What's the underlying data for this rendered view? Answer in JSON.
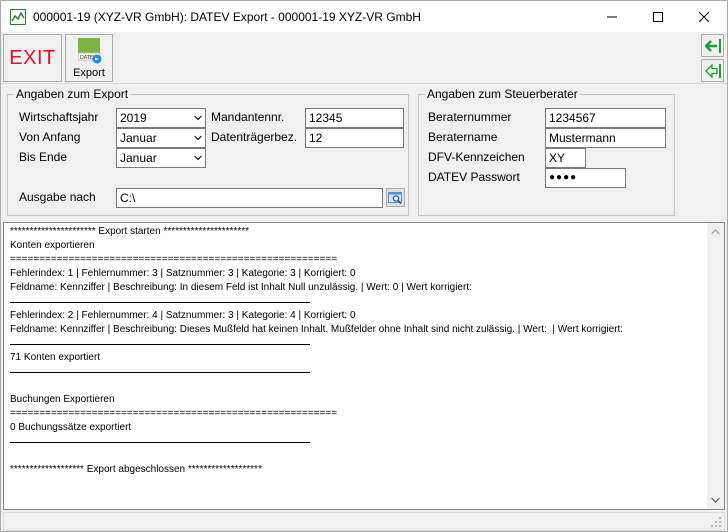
{
  "window": {
    "title": "000001-19 (XYZ-VR GmbH): DATEV Export - 000001-19 XYZ-VR GmbH"
  },
  "toolbar": {
    "exit_label": "EXIT",
    "export_label": "Export",
    "export_icon_text": "DATEV"
  },
  "export_group": {
    "legend": "Angaben zum Export",
    "wirtschaftsjahr_label": "Wirtschaftsjahr",
    "wirtschaftsjahr_value": "2019",
    "von_anfang_label": "Von Anfang",
    "von_anfang_value": "Januar",
    "bis_ende_label": "Bis Ende",
    "bis_ende_value": "Januar",
    "mandantennr_label": "Mandantennr.",
    "mandantennr_value": "12345",
    "datentraeger_label": "Datenträgerbez.",
    "datentraeger_value": "12",
    "ausgabe_label": "Ausgabe nach",
    "ausgabe_value": "C:\\"
  },
  "berater_group": {
    "legend": "Angaben zum Steuerberater",
    "beraternummer_label": "Beraternummer",
    "beraternummer_value": "1234567",
    "beratername_label": "Beratername",
    "beratername_value": "Mustermann",
    "dfv_label": "DFV-Kennzeichen",
    "dfv_value": "XY",
    "passwort_label": "DATEV Passwort",
    "passwort_value": "●●●●"
  },
  "log": {
    "lines": [
      {
        "type": "text",
        "text": "********************** Export starten **********************"
      },
      {
        "type": "text",
        "text": "Konten exportieren"
      },
      {
        "type": "text",
        "text": "========================================================"
      },
      {
        "type": "text",
        "text": "Fehlerindex: 1 | Fehlernummer: 3 | Satznummer: 3 | Kategorie: 3 | Korrigiert: 0"
      },
      {
        "type": "text",
        "text": "Feldname: Kennziffer | Beschreibung: In diesem Feld ist Inhalt Null unzulässig. | Wert: 0 | Wert korrigiert:"
      },
      {
        "type": "rule",
        "text": ""
      },
      {
        "type": "text",
        "text": "Fehlerindex: 2 | Fehlernummer: 4 | Satznummer: 3 | Kategorie: 4 | Korrigiert: 0"
      },
      {
        "type": "text",
        "text": "Feldname: Kennziffer | Beschreibung: Dieses Mußfeld hat keinen Inhalt. Mußfelder ohne Inhalt sind nicht zulässig. | Wert:  | Wert korrigiert:"
      },
      {
        "type": "rule",
        "text": ""
      },
      {
        "type": "text",
        "text": "71 Konten exportiert"
      },
      {
        "type": "rule",
        "text": ""
      },
      {
        "type": "text",
        "text": ""
      },
      {
        "type": "text",
        "text": "Buchungen Exportieren"
      },
      {
        "type": "text",
        "text": "========================================================"
      },
      {
        "type": "text",
        "text": "0 Buchungssätze exportiert"
      },
      {
        "type": "rule",
        "text": ""
      },
      {
        "type": "text",
        "text": ""
      },
      {
        "type": "text",
        "text": "******************* Export abgeschlossen *******************"
      }
    ]
  },
  "colors": {
    "exit_red": "#e81123",
    "arrow_green": "#1e9e3a",
    "border_gray": "#adadad"
  }
}
